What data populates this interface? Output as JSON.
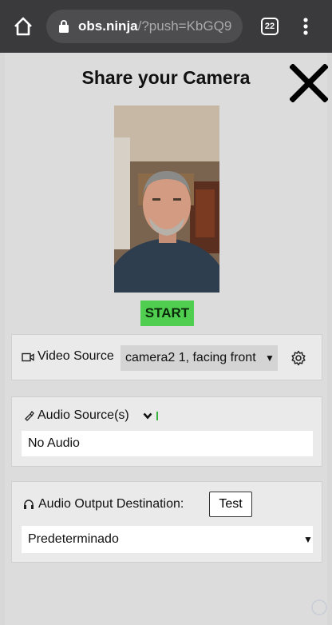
{
  "browser": {
    "url_host": "obs.ninja",
    "url_path": "/?push=KbGQ9",
    "tab_count": "22"
  },
  "page": {
    "title": "Share your Camera",
    "start_label": "START"
  },
  "video": {
    "label": "Video Source",
    "selected": "camera2 1, facing front"
  },
  "audio": {
    "label": "Audio Source(s)",
    "selected": "No Audio"
  },
  "output": {
    "label": "Audio Output Destination:",
    "test_label": "Test",
    "selected": "Predeterminado"
  },
  "colors": {
    "start_button": "#4fce4f",
    "browser_bar": "#3a3a3c"
  }
}
